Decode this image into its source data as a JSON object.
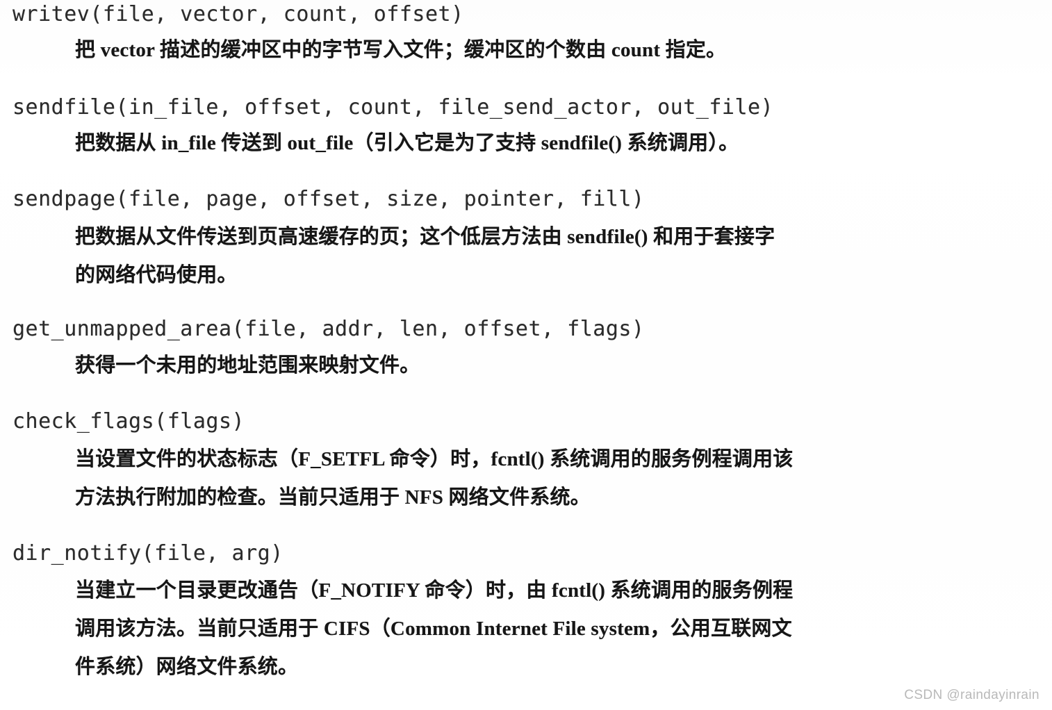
{
  "document": {
    "type": "scanned-book-page",
    "language": "zh-CN",
    "topic": "file_operations methods"
  },
  "entries": [
    {
      "signature": "writev(file, vector, count, offset)",
      "lines": [
        "把 vector 描述的缓冲区中的字节写入文件；缓冲区的个数由 count 指定。"
      ]
    },
    {
      "signature": "sendfile(in_file, offset, count, file_send_actor, out_file)",
      "lines": [
        "把数据从 in_file 传送到 out_file（引入它是为了支持 sendfile() 系统调用）。"
      ]
    },
    {
      "signature": "sendpage(file, page, offset, size, pointer, fill)",
      "lines": [
        "把数据从文件传送到页高速缓存的页；这个低层方法由 sendfile() 和用于套接字",
        "的网络代码使用。"
      ]
    },
    {
      "signature": "get_unmapped_area(file, addr, len, offset, flags)",
      "lines": [
        "获得一个未用的地址范围来映射文件。"
      ]
    },
    {
      "signature": "check_flags(flags)",
      "lines": [
        "当设置文件的状态标志（F_SETFL 命令）时，fcntl() 系统调用的服务例程调用该",
        "方法执行附加的检查。当前只适用于 NFS 网络文件系统。"
      ]
    },
    {
      "signature": "dir_notify(file, arg)",
      "lines": [
        "当建立一个目录更改通告（F_NOTIFY 命令）时，由 fcntl() 系统调用的服务例程",
        "调用该方法。当前只适用于 CIFS（Common Internet File system，公用互联网文",
        "件系统）网络文件系统。"
      ]
    }
  ],
  "watermark": {
    "text": "CSDN @raindayinrain",
    "color": "#b9b9b9"
  }
}
